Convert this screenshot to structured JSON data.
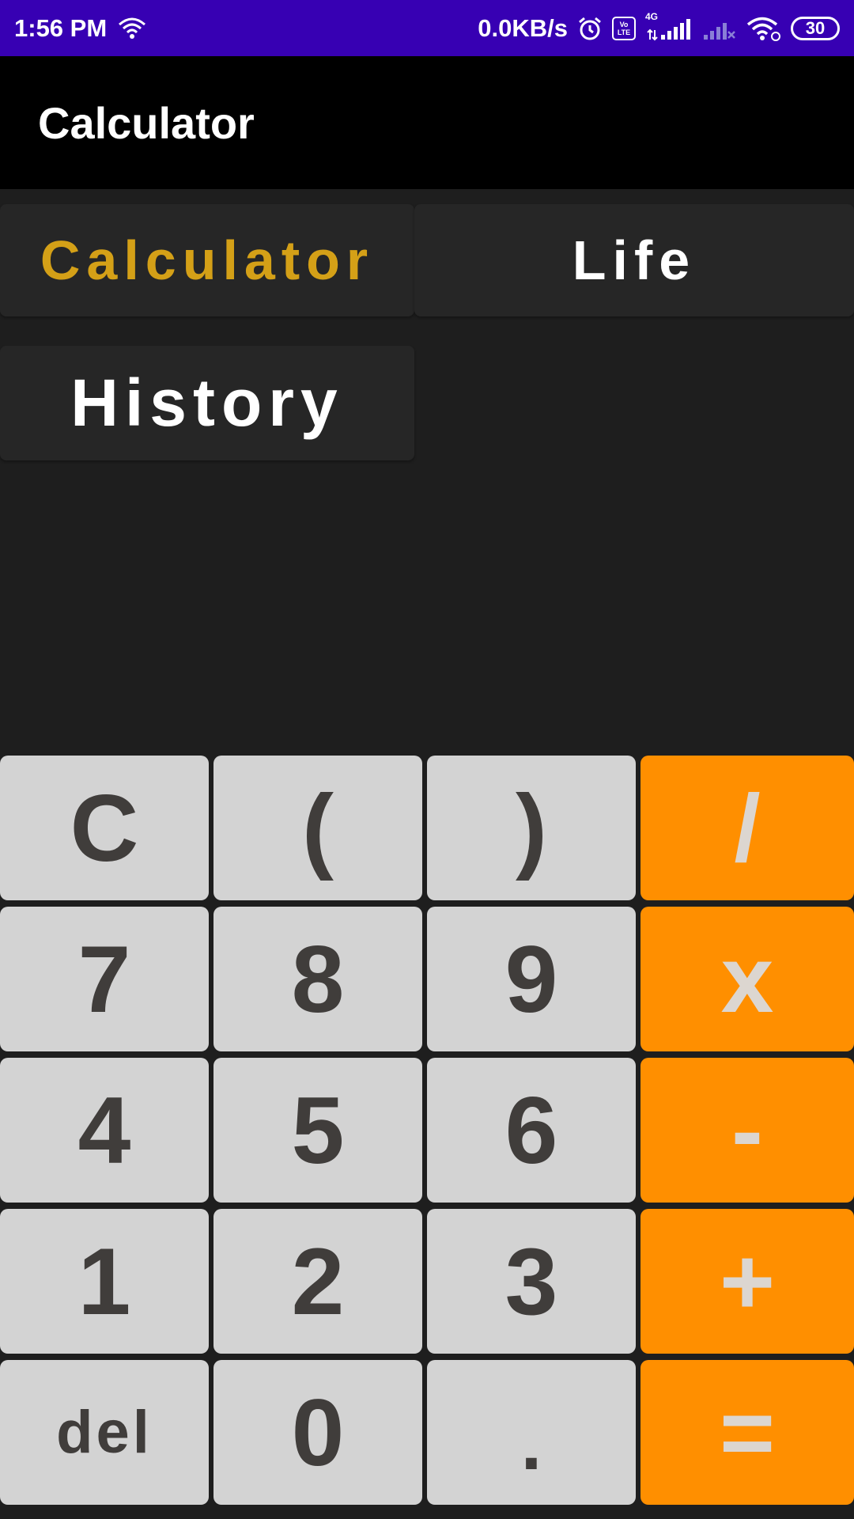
{
  "status_bar": {
    "time": "1:56 PM",
    "network_speed": "0.0KB/s",
    "volte_top": "Vo",
    "volte_bottom": "LTE",
    "network_type": "4G",
    "battery": "30",
    "background_color": "#3700b3",
    "icons": [
      "wifi-icon",
      "alarm-icon",
      "volte-icon",
      "signal-icon",
      "signal-no-service-icon",
      "wifi-icon",
      "battery-icon"
    ]
  },
  "app_bar": {
    "title": "Calculator"
  },
  "modes": {
    "calculator": "Calculator",
    "life": "Life",
    "history": "History",
    "active_color": "#d4a017"
  },
  "display": {
    "expression": ""
  },
  "keypad": {
    "rows": [
      [
        "C",
        "(",
        ")",
        "/"
      ],
      [
        "7",
        "8",
        "9",
        "x"
      ],
      [
        "4",
        "5",
        "6",
        "-"
      ],
      [
        "1",
        "2",
        "3",
        "+"
      ],
      [
        "del",
        "0",
        ".",
        "="
      ]
    ],
    "number_key_color": "#d3d3d3",
    "operator_key_color": "#ff8f00"
  }
}
